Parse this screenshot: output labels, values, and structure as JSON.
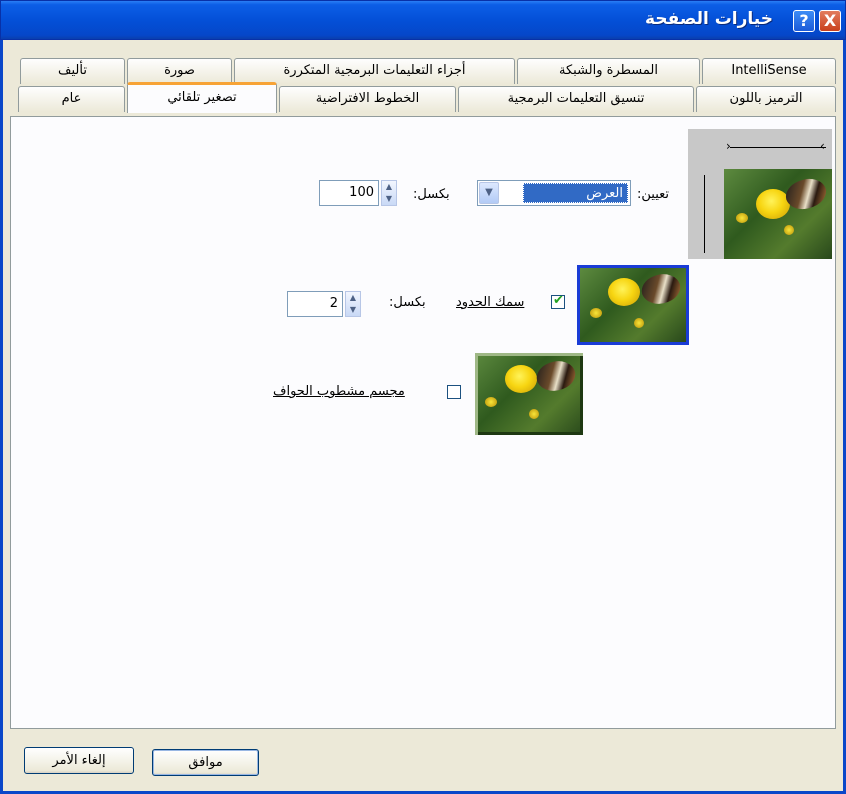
{
  "window": {
    "title": "خيارات الصفحة",
    "close_glyph": "X",
    "help_glyph": "?"
  },
  "tabs": {
    "row_back": [
      "IntelliSense",
      "المسطرة والشبكة",
      "أجزاء التعليمات البرمجية المتكررة",
      "صورة",
      "تأليف"
    ],
    "row_front": [
      "الترميز باللون",
      "تنسيق التعليمات البرمجية",
      "الخطوط الافتراضية",
      "تصغير تلقائي",
      "عام"
    ],
    "active": "تصغير تلقائي"
  },
  "resize": {
    "set_label": "تعيين:",
    "dimension_selected": "العرض",
    "pixels_label": "بكسل:",
    "pixels_value": "100"
  },
  "border": {
    "label": "سمك الحدود",
    "checked": true,
    "pixels_label": "بكسل:",
    "pixels_value": "2"
  },
  "bevel": {
    "label": "مجسم مشطوب الحواف",
    "checked": false
  },
  "buttons": {
    "ok": "موافق",
    "cancel": "إلغاء الأمر"
  },
  "colors": {
    "titlebar": "#0450d8",
    "active_tab_accent": "#f7a336",
    "selection": "#316ac5",
    "border_preview": "#1a3cd6"
  }
}
